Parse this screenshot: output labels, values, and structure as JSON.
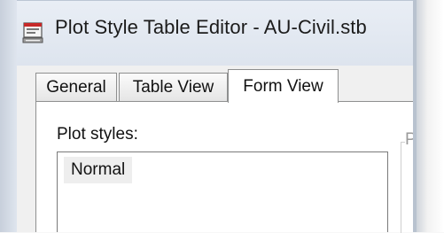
{
  "window": {
    "title": "Plot Style Table Editor - AU-Civil.stb",
    "icon": "plot-style-table-icon"
  },
  "tabs": [
    {
      "label": "General",
      "active": false
    },
    {
      "label": "Table View",
      "active": false
    },
    {
      "label": "Form View",
      "active": true
    }
  ],
  "form": {
    "plot_styles_label": "Plot styles:",
    "plot_styles": [
      "Normal"
    ],
    "properties_group_label": "Pro"
  }
}
